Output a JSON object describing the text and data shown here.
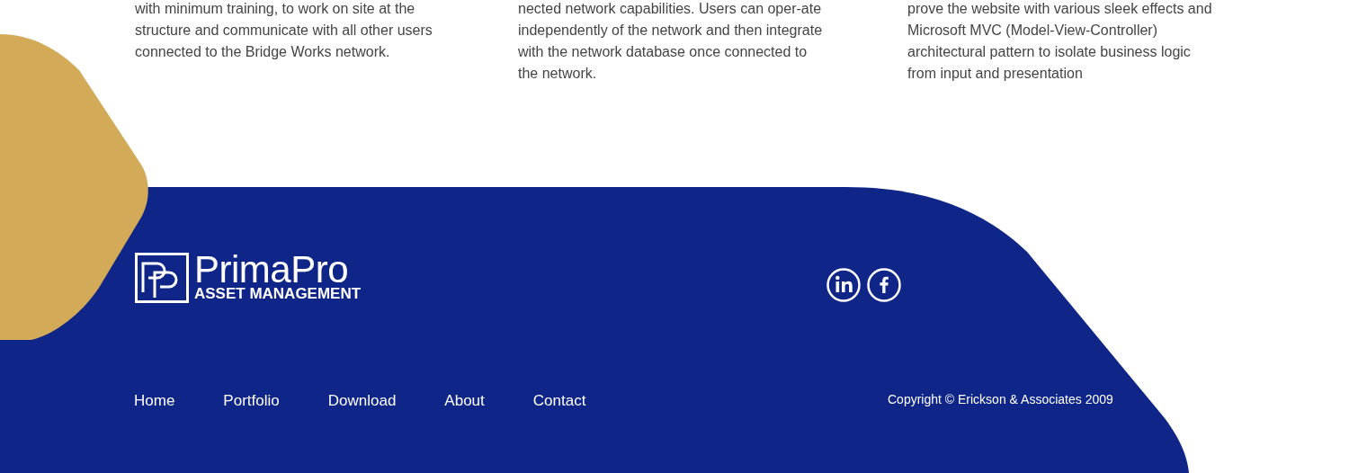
{
  "columns": [
    {
      "text": "with minimum training, to work on site at the structure and communicate with all other users connected to the Bridge Works network."
    },
    {
      "text": "nected network capabilities. Users can oper-ate independently of the network and then integrate with the network database once connected to the network."
    },
    {
      "text": "prove the website with various sleek effects and Microsoft MVC (Model-View-Controller) architectural pattern to isolate business logic from input and presentation"
    }
  ],
  "footer": {
    "logo": {
      "name": "PrimaPro",
      "tagline": "ASSET MANAGEMENT"
    },
    "social": [
      {
        "kind": "linkedin"
      },
      {
        "kind": "facebook"
      }
    ],
    "nav": [
      "Home",
      "Portfolio",
      "Download",
      "About",
      "Contact"
    ],
    "copyright": "Copyright © Erickson & Associates 2009"
  }
}
